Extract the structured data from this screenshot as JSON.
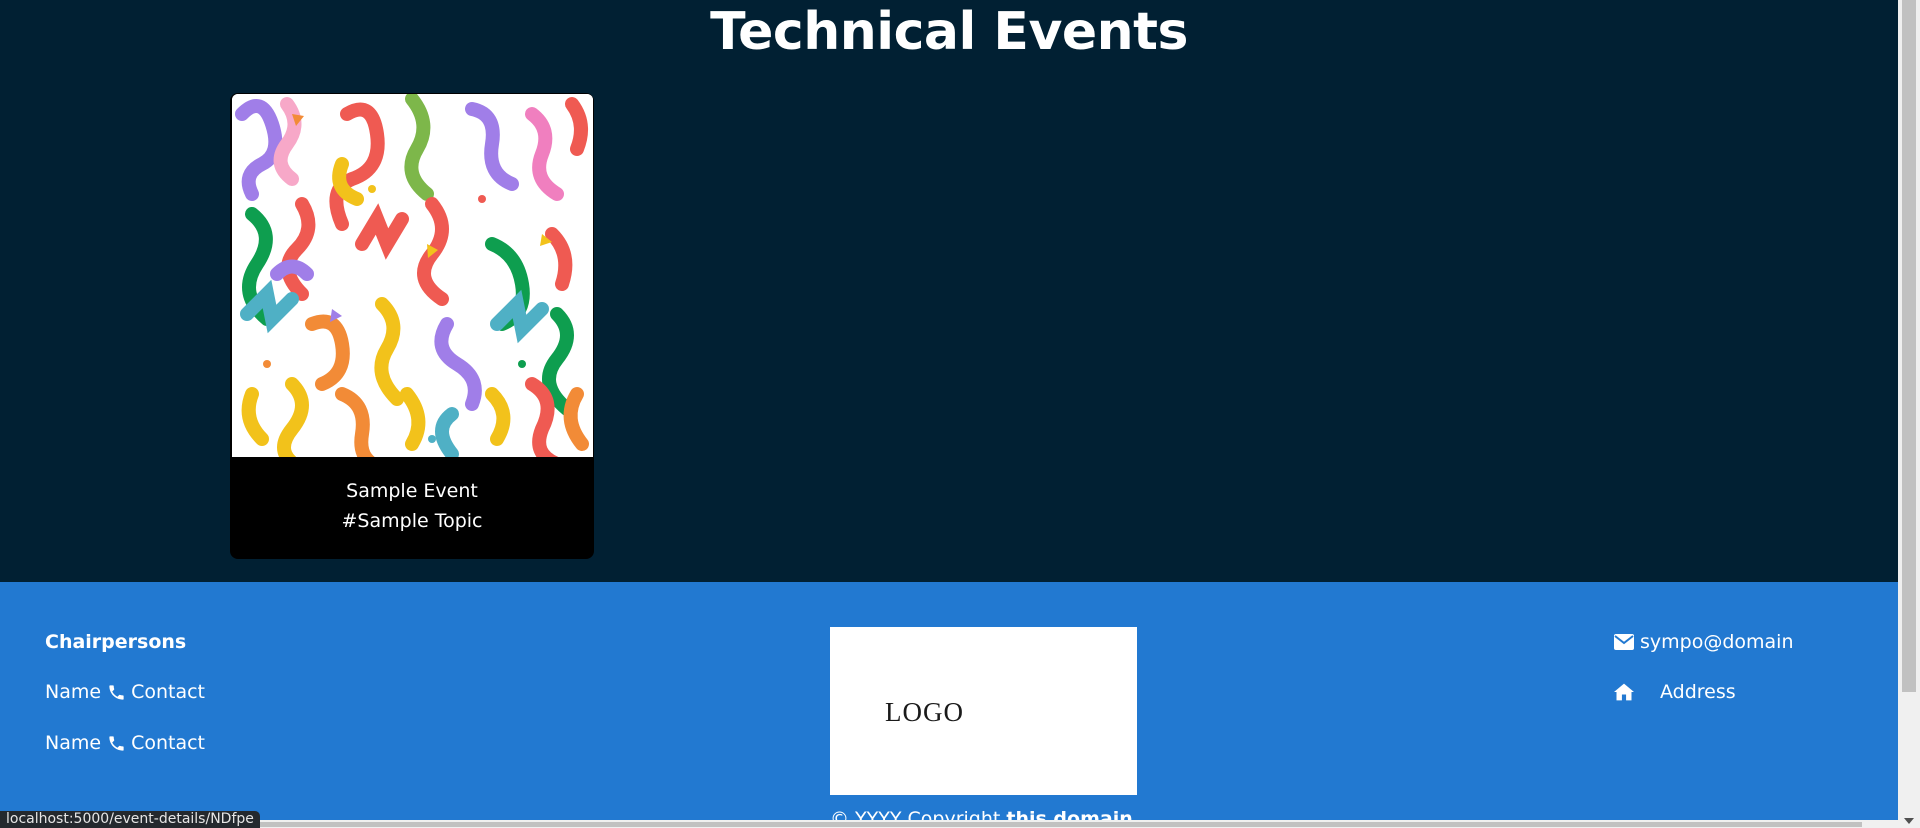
{
  "page": {
    "title": "Technical Events"
  },
  "events": [
    {
      "name": "Sample Event",
      "topic": "#Sample Topic",
      "image_icon": "confetti-pattern"
    }
  ],
  "footer": {
    "chairpersons_heading": "Chairpersons",
    "chairpersons": [
      {
        "name": "Name",
        "contact": "Contact"
      },
      {
        "name": "Name",
        "contact": "Contact"
      }
    ],
    "logo_text": "LOGO",
    "copyright_prefix": "© YYYY Copyright",
    "copyright_brand": "this domain",
    "email": "sympo@domain",
    "address": "Address"
  },
  "status_bar": {
    "url": "localhost:5000/event-details/NDfpe"
  },
  "colors": {
    "hero_bg": "#012033",
    "footer_bg": "#2279d1",
    "card_bg": "#000000",
    "text": "#ffffff"
  },
  "icons": [
    "phone-icon",
    "envelope-icon",
    "home-icon"
  ]
}
